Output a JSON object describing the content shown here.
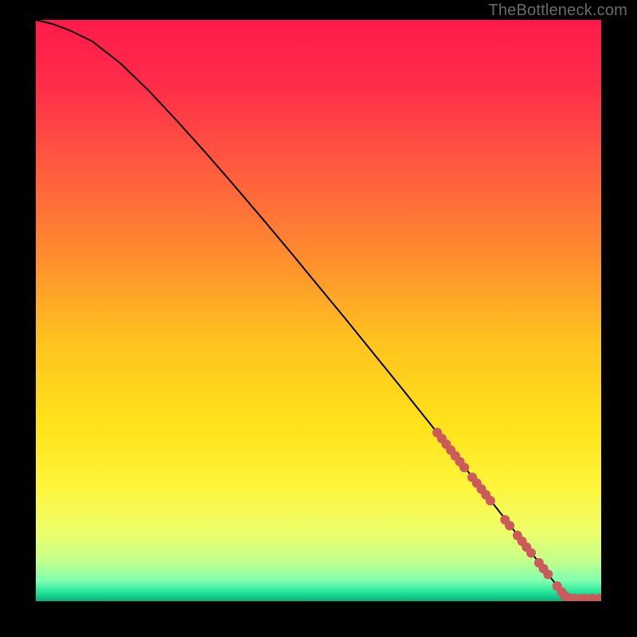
{
  "watermark": "TheBottleneck.com",
  "colors": {
    "gradient_stops": [
      {
        "offset": 0.0,
        "color": "#ff1a4b"
      },
      {
        "offset": 0.12,
        "color": "#ff2f49"
      },
      {
        "offset": 0.25,
        "color": "#ff5a3f"
      },
      {
        "offset": 0.4,
        "color": "#ff8a2f"
      },
      {
        "offset": 0.55,
        "color": "#ffc21f"
      },
      {
        "offset": 0.7,
        "color": "#ffe31a"
      },
      {
        "offset": 0.8,
        "color": "#fff43a"
      },
      {
        "offset": 0.88,
        "color": "#eeff6a"
      },
      {
        "offset": 0.93,
        "color": "#c4ff8a"
      },
      {
        "offset": 0.965,
        "color": "#7fffb0"
      },
      {
        "offset": 0.985,
        "color": "#22e39a"
      },
      {
        "offset": 1.0,
        "color": "#00b37a"
      }
    ],
    "line": "#000000",
    "marker_fill": "#cc5a5a",
    "marker_stroke": "#b94f4f",
    "background": "#000000"
  },
  "chart_data": {
    "type": "line",
    "title": "",
    "xlabel": "",
    "ylabel": "",
    "xlim": [
      0,
      100
    ],
    "ylim": [
      0,
      100
    ],
    "grid": false,
    "series": [
      {
        "name": "curve",
        "x": [
          0,
          3,
          6,
          10,
          15,
          20,
          25,
          30,
          35,
          40,
          45,
          50,
          55,
          60,
          65,
          70,
          75,
          80,
          82,
          84,
          86,
          88,
          90,
          92,
          94,
          96,
          98,
          100
        ],
        "y": [
          100,
          99.3,
          98.2,
          96.3,
          92.5,
          87.8,
          82.6,
          77.2,
          71.6,
          65.9,
          60.1,
          54.2,
          48.3,
          42.3,
          36.3,
          30.2,
          24.1,
          17.9,
          15.4,
          12.9,
          10.4,
          7.9,
          5.4,
          2.9,
          0.9,
          0.45,
          0.45,
          0.45
        ]
      }
    ],
    "markers": [
      {
        "x": 71.0,
        "y": 29.0
      },
      {
        "x": 71.8,
        "y": 28.0
      },
      {
        "x": 72.6,
        "y": 27.0
      },
      {
        "x": 73.4,
        "y": 26.0
      },
      {
        "x": 74.2,
        "y": 25.0
      },
      {
        "x": 75.0,
        "y": 24.0
      },
      {
        "x": 75.8,
        "y": 23.0
      },
      {
        "x": 77.2,
        "y": 21.3
      },
      {
        "x": 78.0,
        "y": 20.3
      },
      {
        "x": 78.8,
        "y": 19.3
      },
      {
        "x": 79.6,
        "y": 18.3
      },
      {
        "x": 80.4,
        "y": 17.3
      },
      {
        "x": 83.0,
        "y": 14.0
      },
      {
        "x": 83.8,
        "y": 13.0
      },
      {
        "x": 85.2,
        "y": 11.3
      },
      {
        "x": 86.0,
        "y": 10.3
      },
      {
        "x": 86.8,
        "y": 9.3
      },
      {
        "x": 87.6,
        "y": 8.3
      },
      {
        "x": 89.0,
        "y": 6.6
      },
      {
        "x": 89.8,
        "y": 5.6
      },
      {
        "x": 90.6,
        "y": 4.6
      },
      {
        "x": 92.2,
        "y": 2.6
      },
      {
        "x": 93.0,
        "y": 1.6
      },
      {
        "x": 93.6,
        "y": 0.9
      },
      {
        "x": 94.2,
        "y": 0.5
      },
      {
        "x": 94.8,
        "y": 0.45
      },
      {
        "x": 95.4,
        "y": 0.45
      },
      {
        "x": 96.6,
        "y": 0.45
      },
      {
        "x": 97.2,
        "y": 0.45
      },
      {
        "x": 98.4,
        "y": 0.45
      },
      {
        "x": 99.6,
        "y": 0.45
      },
      {
        "x": 100.0,
        "y": 0.45
      }
    ]
  }
}
